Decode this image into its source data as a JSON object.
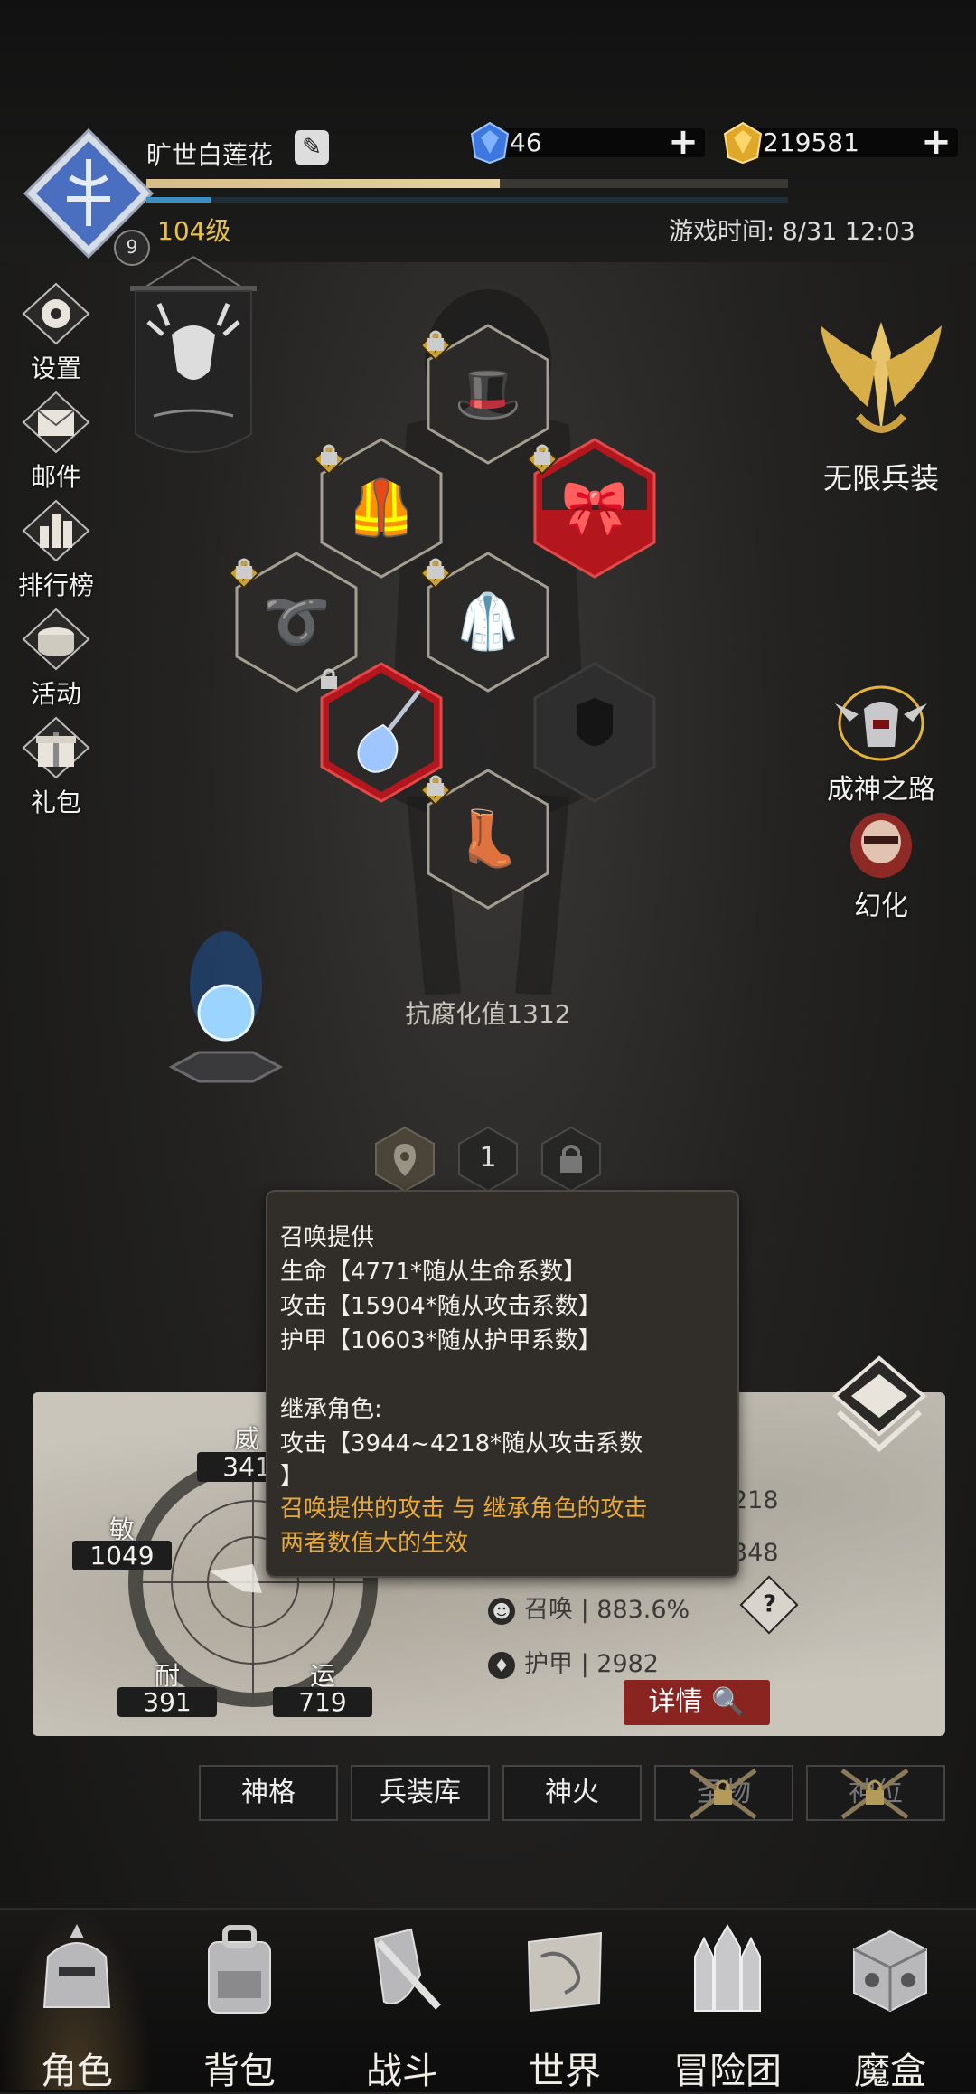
{
  "player": {
    "name": "旷世白莲花",
    "level_text": "104级",
    "badge": "9",
    "exp_fraction": 0.55,
    "mp_fraction": 0.1
  },
  "currency": {
    "gems": "46",
    "gold": "219581"
  },
  "game_time": "游戏时间: 8/31 12:03",
  "left_menu": [
    "设置",
    "邮件",
    "排行榜",
    "活动",
    "礼包"
  ],
  "right_features": {
    "unlimited": "无限兵装",
    "godpath": "成神之路",
    "transform": "幻化"
  },
  "anti_corruption": "抗腐化值1312",
  "slot_tab_number": "1",
  "stats": {
    "wei_label": "威",
    "wei_value": "341",
    "min_label": "敏",
    "min_value": "1049",
    "nai_label": "耐",
    "nai_value": "391",
    "yun_label": "运",
    "yun_value": "719"
  },
  "attrs": {
    "row1_value": "218",
    "row2_value": "348",
    "summon": "召唤 | 883.6%",
    "armor": "护甲 | 2982"
  },
  "details_button": "详情",
  "tooltip": {
    "line1": "召唤提供",
    "line2": "生命【4771*随从生命系数】",
    "line3": "攻击【15904*随从攻击系数】",
    "line4": "护甲【10603*随从护甲系数】",
    "line5": "继承角色:",
    "line6": "攻击【3944~4218*随从攻击系数",
    "line7": "】",
    "line8": "召唤提供的攻击 与 继承角色的攻击",
    "line9": "两者数值大的生效"
  },
  "sub_tabs": [
    "神格",
    "兵装库",
    "神火",
    "圣物",
    "神位"
  ],
  "bottom_nav": [
    "角色",
    "背包",
    "战斗",
    "世界",
    "冒险团",
    "魔盒"
  ],
  "colors": {
    "level_gold": "#e8c04a",
    "tooltip_gold": "#e8a93a",
    "details_red": "#8a2420",
    "rare_red": "#b3161c"
  }
}
